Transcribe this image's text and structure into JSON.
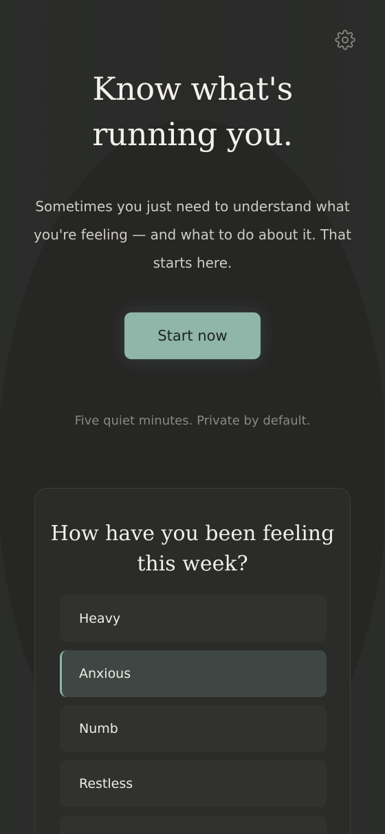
{
  "hero": {
    "title_line1": "Know what's",
    "title_line2": "running you.",
    "subtitle": "Sometimes you just need to understand what you're feeling — and what to do about it. That starts here.",
    "cta_label": "Start now",
    "note": "Five quiet minutes. Private by default."
  },
  "survey": {
    "question": "How have you been feeling this week?",
    "options": [
      {
        "label": "Heavy",
        "selected": false
      },
      {
        "label": "Anxious",
        "selected": true
      },
      {
        "label": "Numb",
        "selected": false
      },
      {
        "label": "Restless",
        "selected": false
      },
      {
        "label": "",
        "selected": false
      }
    ]
  },
  "icons": {
    "settings": "gear-icon"
  },
  "colors": {
    "accent": "#8fb6a8",
    "background": "#2a2a29",
    "card": "#2b2b2a",
    "option": "#313130",
    "option_selected": "#3f4744"
  }
}
